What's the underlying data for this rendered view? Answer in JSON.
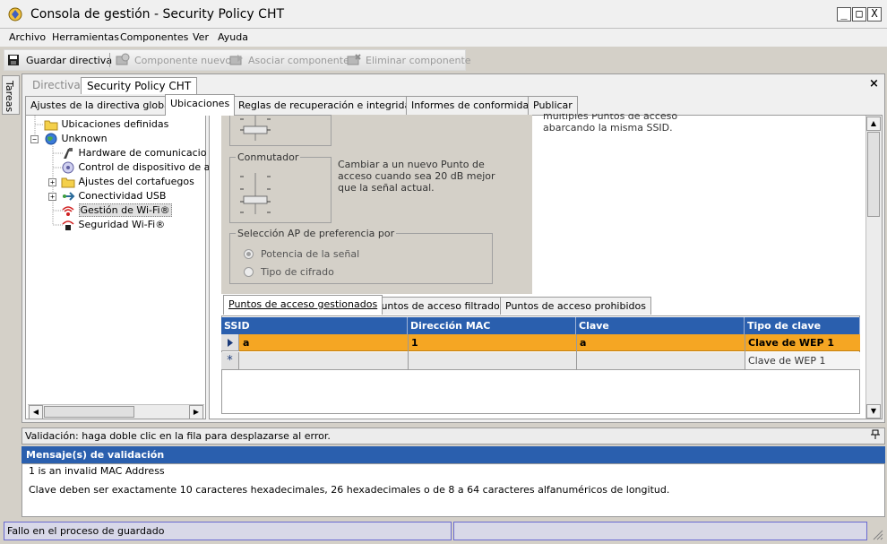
{
  "window": {
    "title": "Consola de gestión - Security Policy CHT",
    "buttons": {
      "minimize": "_",
      "maximize": "□",
      "close": "X"
    }
  },
  "menu": [
    "Archivo",
    "Herramientas",
    "Componentes",
    "Ver",
    "Ayuda"
  ],
  "toolbar": {
    "save": "Guardar directiva",
    "new_component": "Componente nuevo",
    "associate": "Asociar componente",
    "delete": "Eliminar componente"
  },
  "side_tab": "Tareas",
  "doc_tabs": [
    "Directivas",
    "Security Policy CHT"
  ],
  "close_symbol": "×",
  "section_tabs": [
    "Ajustes de la directiva global",
    "Ubicaciones",
    "Reglas de recuperación e integridad",
    "Informes de conformidad",
    "Publicar"
  ],
  "tree": {
    "items": [
      {
        "label": "Ubicaciones definidas",
        "icon": "folder-icon"
      },
      {
        "label": "Unknown",
        "icon": "globe-icon"
      },
      {
        "label": "Hardware de comunicacio",
        "icon": "hardware-icon"
      },
      {
        "label": "Control de dispositivo de al",
        "icon": "device-control-icon"
      },
      {
        "label": "Ajustes del cortafuegos",
        "icon": "folder-icon"
      },
      {
        "label": "Conectividad USB",
        "icon": "usb-icon"
      },
      {
        "label": "Gestión de Wi-Fi®",
        "icon": "wifi-icon"
      },
      {
        "label": "Seguridad Wi-Fi®",
        "icon": "wifi-security-icon"
      }
    ],
    "expander_plus": "+",
    "expander_minus": "−"
  },
  "settings": {
    "commutator_label": "Conmutador",
    "commutator_desc": "Cambiar a un nuevo Punto de acceso cuando sea 20 dB mejor que la señal actual.",
    "right_desc": "múltiples Puntos de acceso abarcando la misma SSID.",
    "ap_pref_label": "Selección AP de preferencia por",
    "radio_signal": "Potencia de la señal",
    "radio_cipher": "Tipo de cifrado"
  },
  "grid_tabs": [
    "Puntos de acceso gestionados",
    "Puntos de acceso filtrados",
    "Puntos de acceso prohibidos"
  ],
  "grid": {
    "headers": [
      "SSID",
      "Dirección MAC",
      "Clave",
      "Tipo de clave"
    ],
    "rows": [
      [
        "a",
        "1",
        "a",
        "Clave de WEP 1"
      ],
      [
        "",
        "",
        "",
        "Clave de WEP 1"
      ]
    ],
    "new_row_marker": "*"
  },
  "validation": {
    "hint": "Validación: haga doble clic en la fila para desplazarse al error.",
    "header": "Mensaje(s) de validación",
    "messages": [
      "1 is an invalid MAC Address",
      "Clave deben ser exactamente 10 caracteres hexadecimales, 26 hexadecimales o de 8 a 64 caracteres alfanuméricos de longitud."
    ]
  },
  "status": {
    "text": "Fallo en el proceso de guardado"
  },
  "colors": {
    "grid_header": "#2a5fae",
    "selected_row": "#f5a623",
    "status_border": "#6a6ad0"
  }
}
